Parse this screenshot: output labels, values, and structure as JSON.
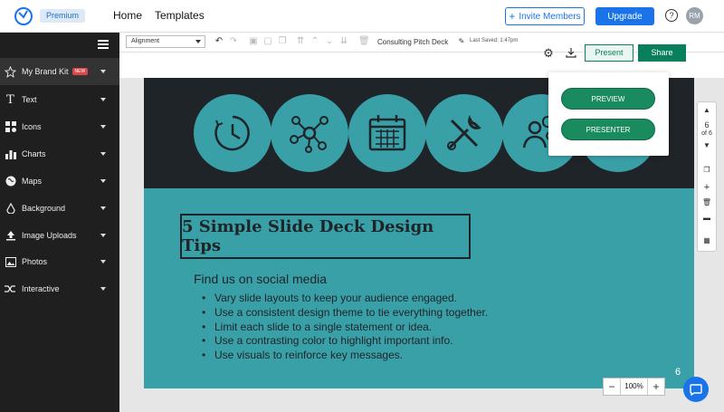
{
  "header": {
    "premium_label": "Premium",
    "nav": [
      "Home",
      "Templates"
    ],
    "invite_label": "Invite Members",
    "upgrade_label": "Upgrade",
    "help_label": "?",
    "avatar_initials": "RM"
  },
  "sidebar": {
    "items": [
      {
        "label": "My Brand Kit",
        "icon": "star-icon",
        "badge": "NEW"
      },
      {
        "label": "Text",
        "icon": "text-icon"
      },
      {
        "label": "Icons",
        "icon": "icons-icon"
      },
      {
        "label": "Charts",
        "icon": "chart-icon"
      },
      {
        "label": "Maps",
        "icon": "globe-icon"
      },
      {
        "label": "Background",
        "icon": "fill-icon"
      },
      {
        "label": "Image Uploads",
        "icon": "upload-icon"
      },
      {
        "label": "Photos",
        "icon": "photo-icon"
      },
      {
        "label": "Interactive",
        "icon": "shuffle-icon"
      }
    ]
  },
  "toolbar": {
    "alignment_value": "Alignment",
    "doc_title": "Consulting Pitch Deck",
    "last_saved": "Last Saved: 1:47pm"
  },
  "actions": {
    "present_label": "Present",
    "share_label": "Share"
  },
  "present_menu": {
    "preview_label": "PREVIEW",
    "presenter_label": "PRESENTER"
  },
  "slide": {
    "title": "5 Simple Slide Deck Design Tips",
    "subtitle": "Find us on social media",
    "bullets": [
      "Vary slide layouts to keep your audience engaged.",
      "Use a consistent design theme to tie everything together.",
      "Limit each slide to a single statement or idea.",
      "Use a contrasting color to highlight important info.",
      "Use visuals to reinforce key messages."
    ],
    "page_number": "6"
  },
  "rail": {
    "current_page": "6",
    "page_of": "of 6"
  },
  "zoom": {
    "value": "100%",
    "minus": "−",
    "plus": "+"
  },
  "colors": {
    "accent_blue": "#1a73e8",
    "green": "#0a7f5c",
    "teal": "#3aa0a8",
    "dark": "#1e2428"
  }
}
